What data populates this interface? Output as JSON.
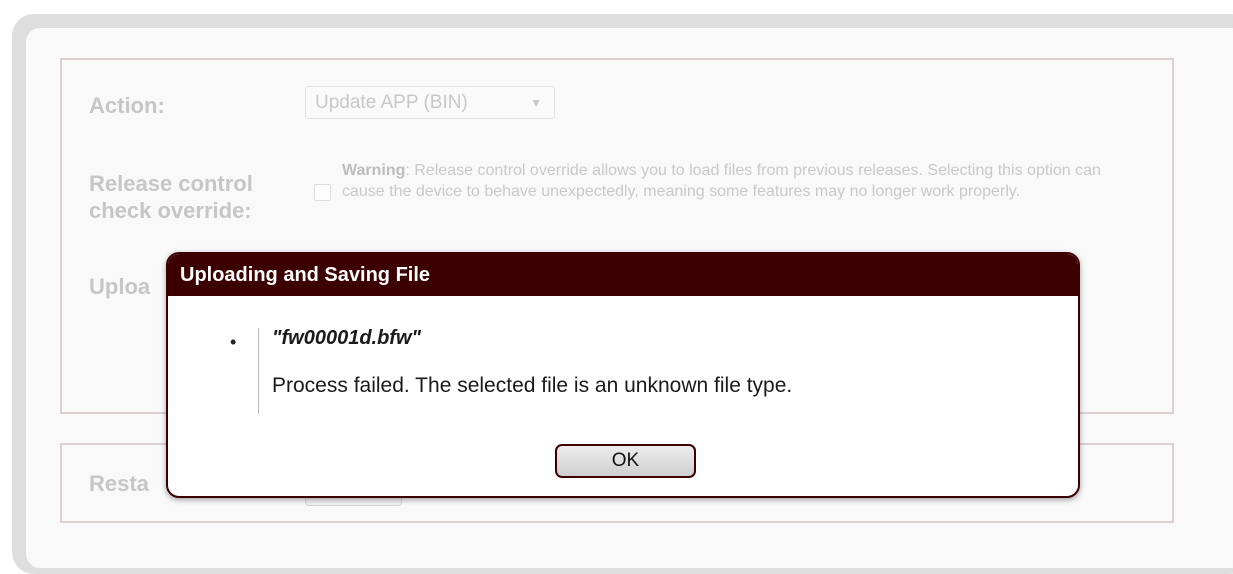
{
  "form": {
    "action_label": "Action:",
    "action_value": "Update APP (BIN)",
    "release_label_line1": "Release control",
    "release_label_line2": "check override:",
    "warning_bold": "Warning",
    "warning_text": ": Release control override allows you to load files from previous releases. Selecting this option can cause the device to behave unexpectedly, meaning some features may no longer work properly.",
    "upload_label": "Uploa",
    "restart_label": "Resta"
  },
  "dialog": {
    "title": "Uploading and Saving File",
    "bullet": "•",
    "file_name": "\"fw00001d.bfw\"",
    "message": "Process failed. The selected file is an unknown file type.",
    "ok_label": "OK"
  },
  "colors": {
    "dialog_header": "#3d0000",
    "panel_border": "#ddd0d0"
  },
  "icons": {
    "select_arrow": "triangle-down-icon"
  }
}
